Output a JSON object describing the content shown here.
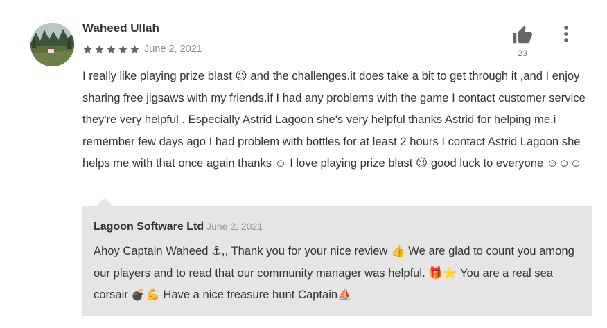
{
  "review": {
    "author": "Waheed Ullah",
    "rating": 5,
    "rating_max": 5,
    "date": "June 2, 2021",
    "like_count": "23",
    "body": "I really like playing prize blast 😉 and the challenges.it does take a bit to get through it ,and I enjoy sharing free jigsaws with my friends.if I had any problems with the game I contact customer service they're very helpful . Especially Astrid Lagoon she's very helpful thanks Astrid for helping me.i remember few days ago I had problem with bottles for at least 2 hours I contact Astrid Lagoon she helps me with that once again thanks ☺ I love playing prize blast 😉 good luck to everyone ☺☺☺"
  },
  "reply": {
    "author": "Lagoon Software Ltd",
    "date": "June 2, 2021",
    "body": "Ahoy Captain Waheed ⚓,, Thank you for your nice review 👍 We are glad to count you among our players and to read that our community manager was helpful. 🎁⭐ You are a real sea corsair 💣💪 Have a nice treasure hunt Captain⛵"
  },
  "icons": {
    "like": "thumbs-up-icon",
    "more": "more-vertical-icon",
    "star": "star-icon",
    "avatar": "user-avatar"
  },
  "colors": {
    "text": "#333333",
    "muted": "#8a8a8a",
    "icon": "#666666",
    "reply_bg": "#e5e5e5"
  }
}
